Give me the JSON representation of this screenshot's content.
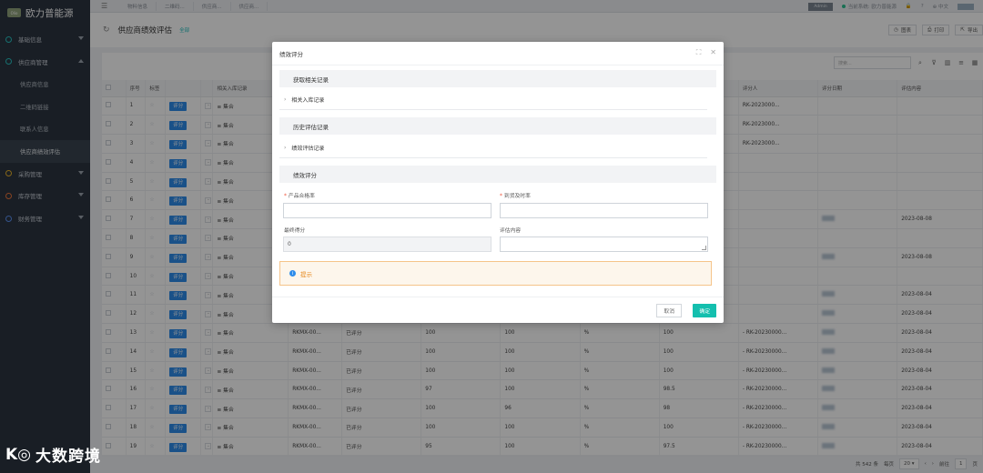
{
  "app": {
    "logo_badge": "Olio",
    "name": "欧力普能源"
  },
  "sidebar": {
    "items": [
      {
        "label": "基础信息",
        "expanded": false
      },
      {
        "label": "供应商管理",
        "expanded": true,
        "children": [
          "供应商信息",
          "二维码链接",
          "联系人信息",
          "供应商绩效评估"
        ]
      },
      {
        "label": "采购管理",
        "expanded": false
      },
      {
        "label": "库存管理",
        "expanded": false
      },
      {
        "label": "财务管理",
        "expanded": false
      }
    ],
    "active_child": "供应商绩效评估"
  },
  "topbar": {
    "tags": [
      "物料信息",
      "二维码...",
      "供应商...",
      "供应商..."
    ],
    "pill": "Admin",
    "company_label": "当前系统: 欧力普能源",
    "lang": "中文"
  },
  "page": {
    "title": "供应商绩效评估",
    "filter": "全部",
    "buttons": [
      "图表",
      "打印",
      "导出"
    ]
  },
  "table": {
    "search_placeholder": "搜索...",
    "headers": [
      "",
      "序号",
      "标签",
      "",
      "",
      "相关入库记录",
      "",
      "",
      "",
      "",
      "",
      "",
      "评分人",
      "评分日期",
      "评估内容"
    ],
    "rows": [
      {
        "no": "1",
        "rate": "评分",
        "combo": "≡ 集合",
        "code": "",
        "status": "",
        "a": "",
        "b": "",
        "c": "",
        "d": "",
        "rk": "RK-2023000...",
        "date": ""
      },
      {
        "no": "2",
        "rate": "评分",
        "combo": "≡ 集合",
        "code": "",
        "status": "",
        "a": "",
        "b": "",
        "c": "",
        "d": "",
        "rk": "RK-2023000...",
        "date": ""
      },
      {
        "no": "3",
        "rate": "评分",
        "combo": "≡ 集合",
        "code": "",
        "status": "",
        "a": "",
        "b": "",
        "c": "",
        "d": "",
        "rk": "RK-2023000...",
        "date": ""
      },
      {
        "no": "4",
        "rate": "评分",
        "combo": "≡ 集合",
        "code": "",
        "status": "",
        "a": "",
        "b": "",
        "c": "",
        "d": "",
        "rk": "",
        "date": ""
      },
      {
        "no": "5",
        "rate": "评分",
        "combo": "≡ 集合",
        "code": "",
        "status": "",
        "a": "",
        "b": "",
        "c": "",
        "d": "",
        "rk": "",
        "date": ""
      },
      {
        "no": "6",
        "rate": "评分",
        "combo": "≡ 集合",
        "code": "",
        "status": "",
        "a": "",
        "b": "",
        "c": "",
        "d": "",
        "rk": "",
        "date": ""
      },
      {
        "no": "7",
        "rate": "评分",
        "combo": "≡ 集合",
        "code": "",
        "status": "",
        "a": "",
        "b": "",
        "c": "",
        "d": "",
        "rk": "",
        "date": "2023-08-08"
      },
      {
        "no": "8",
        "rate": "评分",
        "combo": "≡ 集合",
        "code": "",
        "status": "",
        "a": "",
        "b": "",
        "c": "",
        "d": "",
        "rk": "",
        "date": ""
      },
      {
        "no": "9",
        "rate": "评分",
        "combo": "≡ 集合",
        "code": "",
        "status": "",
        "a": "",
        "b": "",
        "c": "",
        "d": "",
        "rk": "",
        "date": "2023-08-08"
      },
      {
        "no": "10",
        "rate": "评分",
        "combo": "≡ 集合",
        "code": "",
        "status": "",
        "a": "",
        "b": "",
        "c": "",
        "d": "",
        "rk": "",
        "date": ""
      },
      {
        "no": "11",
        "rate": "评分",
        "combo": "≡ 集合",
        "code": "",
        "status": "",
        "a": "",
        "b": "",
        "c": "",
        "d": "",
        "rk": "",
        "date": "2023-08-04"
      },
      {
        "no": "12",
        "rate": "评分",
        "combo": "≡ 集合",
        "code": "",
        "status": "",
        "a": "",
        "b": "",
        "c": "",
        "d": "",
        "rk": "",
        "date": "2023-08-04"
      },
      {
        "no": "13",
        "rate": "评分",
        "combo": "≡ 集合",
        "code": "RKMX-00...",
        "status": "已评分",
        "a": "100",
        "b": "100",
        "c": "%",
        "d": "100",
        "rk": "- RK-20230000...",
        "date": "2023-08-04"
      },
      {
        "no": "14",
        "rate": "评分",
        "combo": "≡ 集合",
        "code": "RKMX-00...",
        "status": "已评分",
        "a": "100",
        "b": "100",
        "c": "%",
        "d": "100",
        "rk": "- RK-20230000...",
        "date": "2023-08-04"
      },
      {
        "no": "15",
        "rate": "评分",
        "combo": "≡ 集合",
        "code": "RKMX-00...",
        "status": "已评分",
        "a": "100",
        "b": "100",
        "c": "%",
        "d": "100",
        "rk": "- RK-20230000...",
        "date": "2023-08-04"
      },
      {
        "no": "16",
        "rate": "评分",
        "combo": "≡ 集合",
        "code": "RKMX-00...",
        "status": "已评分",
        "a": "97",
        "b": "100",
        "c": "%",
        "d": "98.5",
        "rk": "- RK-20230000...",
        "date": "2023-08-04"
      },
      {
        "no": "17",
        "rate": "评分",
        "combo": "≡ 集合",
        "code": "RKMX-00...",
        "status": "已评分",
        "a": "100",
        "b": "96",
        "c": "%",
        "d": "98",
        "rk": "- RK-20230000...",
        "date": "2023-08-04"
      },
      {
        "no": "18",
        "rate": "评分",
        "combo": "≡ 集合",
        "code": "RKMX-00...",
        "status": "已评分",
        "a": "100",
        "b": "100",
        "c": "%",
        "d": "100",
        "rk": "- RK-20230000...",
        "date": "2023-08-04"
      },
      {
        "no": "19",
        "rate": "评分",
        "combo": "≡ 集合",
        "code": "RKMX-00...",
        "status": "已评分",
        "a": "95",
        "b": "100",
        "c": "%",
        "d": "97.5",
        "rk": "- RK-20230000...",
        "date": "2023-08-04"
      }
    ]
  },
  "pager": {
    "total": "共 542 条",
    "per_page_label": "每页",
    "per_page": "20",
    "goto_label": "前往",
    "page": "1",
    "page_unit": "页"
  },
  "modal": {
    "title": "绩效评分",
    "section_fetch": "获取相关记录",
    "row_inbound": "相关入库记录",
    "section_history": "历史评估记录",
    "row_history": "绩效评估记录",
    "section_score": "绩效评分",
    "field_quality": "产品合格率",
    "field_ontime": "到货及时率",
    "field_final": "最终得分",
    "field_final_value": "0",
    "field_content": "评估内容",
    "tip": "提示",
    "cancel": "取消",
    "confirm": "确定"
  },
  "watermark": {
    "text": "大数跨境"
  }
}
